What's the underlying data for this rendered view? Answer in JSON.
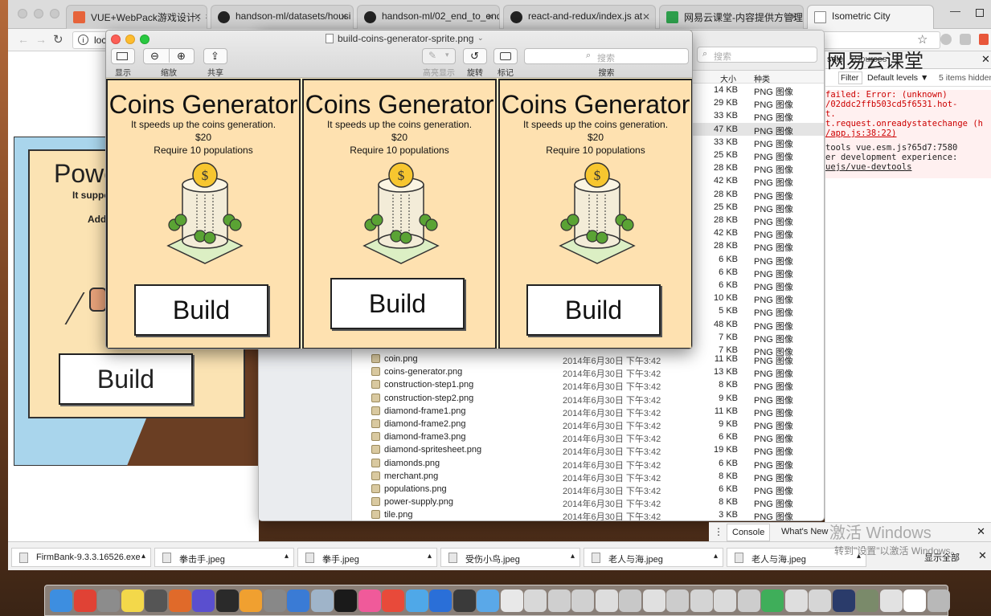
{
  "browser": {
    "tabs": [
      {
        "label": "VUE+WebPack游戏设计：欲"
      },
      {
        "label": "handson-ml/datasets/housi"
      },
      {
        "label": "handson-ml/02_end_to_end"
      },
      {
        "label": "react-and-redux/index.js at"
      },
      {
        "label": "网易云课堂-内容提供方管理后"
      },
      {
        "label": "Isometric City"
      }
    ],
    "url": "loca",
    "window_min": "—"
  },
  "preview": {
    "title": "build-coins-generator-sprite.png",
    "toolbar": {
      "display": "显示",
      "zoom": "缩放",
      "share": "共享",
      "highlight": "高亮显示",
      "rotate": "旋转",
      "markup": "标记",
      "search_placeholder": "搜索",
      "search_label": "搜索"
    },
    "cards": [
      {
        "title": "Coins Generator",
        "desc": "It speeds up the coins generation.",
        "price": "$20",
        "req": "Require 10 populations",
        "button": "Build"
      },
      {
        "title": "Coins Generator",
        "desc": "It speeds up the coins generation.",
        "price": "$20",
        "req": "Require 10 populations",
        "button": "Build"
      },
      {
        "title": "Coins Generator",
        "desc": "It speeds up the coins generation.",
        "price": "$20",
        "req": "Require 10 populations",
        "button": "Build"
      }
    ]
  },
  "backpage": {
    "title": "Powe",
    "desc": "It suppo",
    "add": "Add",
    "button": "Build"
  },
  "finder": {
    "search_placeholder": "搜索",
    "col_size": "大小",
    "col_kind": "种类",
    "top_rows": [
      {
        "size": "14 KB",
        "kind": "PNG 图像"
      },
      {
        "size": "29 KB",
        "kind": "PNG 图像"
      },
      {
        "size": "33 KB",
        "kind": "PNG 图像"
      },
      {
        "size": "47 KB",
        "kind": "PNG 图像"
      },
      {
        "size": "33 KB",
        "kind": "PNG 图像"
      },
      {
        "size": "25 KB",
        "kind": "PNG 图像"
      },
      {
        "size": "28 KB",
        "kind": "PNG 图像"
      },
      {
        "size": "42 KB",
        "kind": "PNG 图像"
      },
      {
        "size": "28 KB",
        "kind": "PNG 图像"
      },
      {
        "size": "25 KB",
        "kind": "PNG 图像"
      },
      {
        "size": "28 KB",
        "kind": "PNG 图像"
      },
      {
        "size": "42 KB",
        "kind": "PNG 图像"
      },
      {
        "size": "28 KB",
        "kind": "PNG 图像"
      },
      {
        "size": "6 KB",
        "kind": "PNG 图像"
      },
      {
        "size": "6 KB",
        "kind": "PNG 图像"
      },
      {
        "size": "6 KB",
        "kind": "PNG 图像"
      },
      {
        "size": "10 KB",
        "kind": "PNG 图像"
      },
      {
        "size": "5 KB",
        "kind": "PNG 图像"
      },
      {
        "size": "48 KB",
        "kind": "PNG 图像"
      },
      {
        "size": "7 KB",
        "kind": "PNG 图像"
      },
      {
        "size": "7 KB",
        "kind": "PNG 图像"
      }
    ],
    "files": [
      {
        "name": "coin.png",
        "date": "2014年6月30日 下午3:42",
        "size": "11 KB",
        "kind": "PNG 图像"
      },
      {
        "name": "coins-generator.png",
        "date": "2014年6月30日 下午3:42",
        "size": "13 KB",
        "kind": "PNG 图像"
      },
      {
        "name": "construction-step1.png",
        "date": "2014年6月30日 下午3:42",
        "size": "8 KB",
        "kind": "PNG 图像"
      },
      {
        "name": "construction-step2.png",
        "date": "2014年6月30日 下午3:42",
        "size": "9 KB",
        "kind": "PNG 图像"
      },
      {
        "name": "diamond-frame1.png",
        "date": "2014年6月30日 下午3:42",
        "size": "11 KB",
        "kind": "PNG 图像"
      },
      {
        "name": "diamond-frame2.png",
        "date": "2014年6月30日 下午3:42",
        "size": "9 KB",
        "kind": "PNG 图像"
      },
      {
        "name": "diamond-frame3.png",
        "date": "2014年6月30日 下午3:42",
        "size": "6 KB",
        "kind": "PNG 图像"
      },
      {
        "name": "diamond-spritesheet.png",
        "date": "2014年6月30日 下午3:42",
        "size": "19 KB",
        "kind": "PNG 图像"
      },
      {
        "name": "diamonds.png",
        "date": "2014年6月30日 下午3:42",
        "size": "6 KB",
        "kind": "PNG 图像"
      },
      {
        "name": "merchant.png",
        "date": "2014年6月30日 下午3:42",
        "size": "8 KB",
        "kind": "PNG 图像"
      },
      {
        "name": "populations.png",
        "date": "2014年6月30日 下午3:42",
        "size": "6 KB",
        "kind": "PNG 图像"
      },
      {
        "name": "power-supply.png",
        "date": "2014年6月30日 下午3:42",
        "size": "8 KB",
        "kind": "PNG 图像"
      },
      {
        "name": "tile.png",
        "date": "2014年6月30日 下午3:42",
        "size": "3 KB",
        "kind": "PNG 图像"
      }
    ]
  },
  "devtools": {
    "tab_console": "sole",
    "tab_sources": "Sources",
    "brand": "网易云课堂",
    "filter": "Filter",
    "levels": "Default levels ▼",
    "hidden": "5 items hidden b",
    "lines": [
      "failed: Error:        (unknown)",
      "/02ddc2ffb503cd5f6531.hot-",
      "t.",
      "t.request.onreadystatechange (h",
      "/app.js:38:22)",
      "tools       vue.esm.js?65d7:7580",
      "er development experience:",
      "uejs/vue-devtools"
    ],
    "drawer_console": "Console",
    "drawer_whatsnew": "What's New",
    "activate_title": "激活 Windows",
    "activate_sub": "转到\"设置\"以激活 Windows。"
  },
  "downloads": {
    "items": [
      {
        "label": "FirmBank-9.3.3.16526.exe"
      },
      {
        "label": "拳击手.jpeg"
      },
      {
        "label": "拳手.jpeg"
      },
      {
        "label": "受伤小鸟.jpeg"
      },
      {
        "label": "老人与海.jpeg"
      },
      {
        "label": "老人与海.jpeg"
      }
    ],
    "show_all": "显示全部"
  },
  "colors": {
    "card_bg": "#fee1b0",
    "sky": "#a9d5ec",
    "accent_blue": "#1a73e8"
  }
}
